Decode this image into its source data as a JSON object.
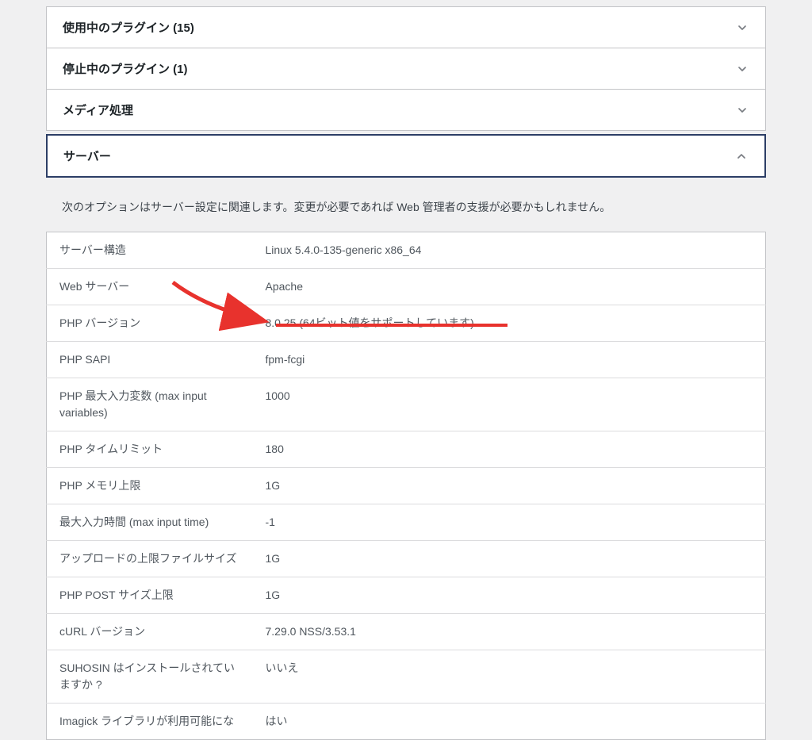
{
  "accordions": {
    "active_plugins": {
      "label": "使用中のプラグイン (15)"
    },
    "inactive_plugins": {
      "label": "停止中のプラグイン (1)"
    },
    "media_handling": {
      "label": "メディア処理"
    },
    "server": {
      "label": "サーバー"
    }
  },
  "server_panel": {
    "description": "次のオプションはサーバー設定に関連します。変更が必要であれば Web 管理者の支援が必要かもしれません。",
    "rows": [
      {
        "label": "サーバー構造",
        "value": "Linux 5.4.0-135-generic x86_64"
      },
      {
        "label": "Web サーバー",
        "value": "Apache"
      },
      {
        "label": "PHP バージョン",
        "value": "8.0.25 (64ビット値をサポートしています)"
      },
      {
        "label": "PHP SAPI",
        "value": "fpm-fcgi"
      },
      {
        "label": "PHP 最大入力変数 (max input variables)",
        "value": "1000"
      },
      {
        "label": "PHP タイムリミット",
        "value": "180"
      },
      {
        "label": "PHP メモリ上限",
        "value": "1G"
      },
      {
        "label": "最大入力時間 (max input time)",
        "value": "-1"
      },
      {
        "label": "アップロードの上限ファイルサイズ",
        "value": "1G"
      },
      {
        "label": "PHP POST サイズ上限",
        "value": "1G"
      },
      {
        "label": "cURL バージョン",
        "value": "7.29.0 NSS/3.53.1"
      },
      {
        "label": "SUHOSIN はインストールされていますか ?",
        "value": "いいえ"
      },
      {
        "label": "Imagick ライブラリが利用可能にな",
        "value": "はい"
      }
    ]
  },
  "annotation": {
    "arrow_color": "#e8322d",
    "underline_color": "#e8322d"
  }
}
